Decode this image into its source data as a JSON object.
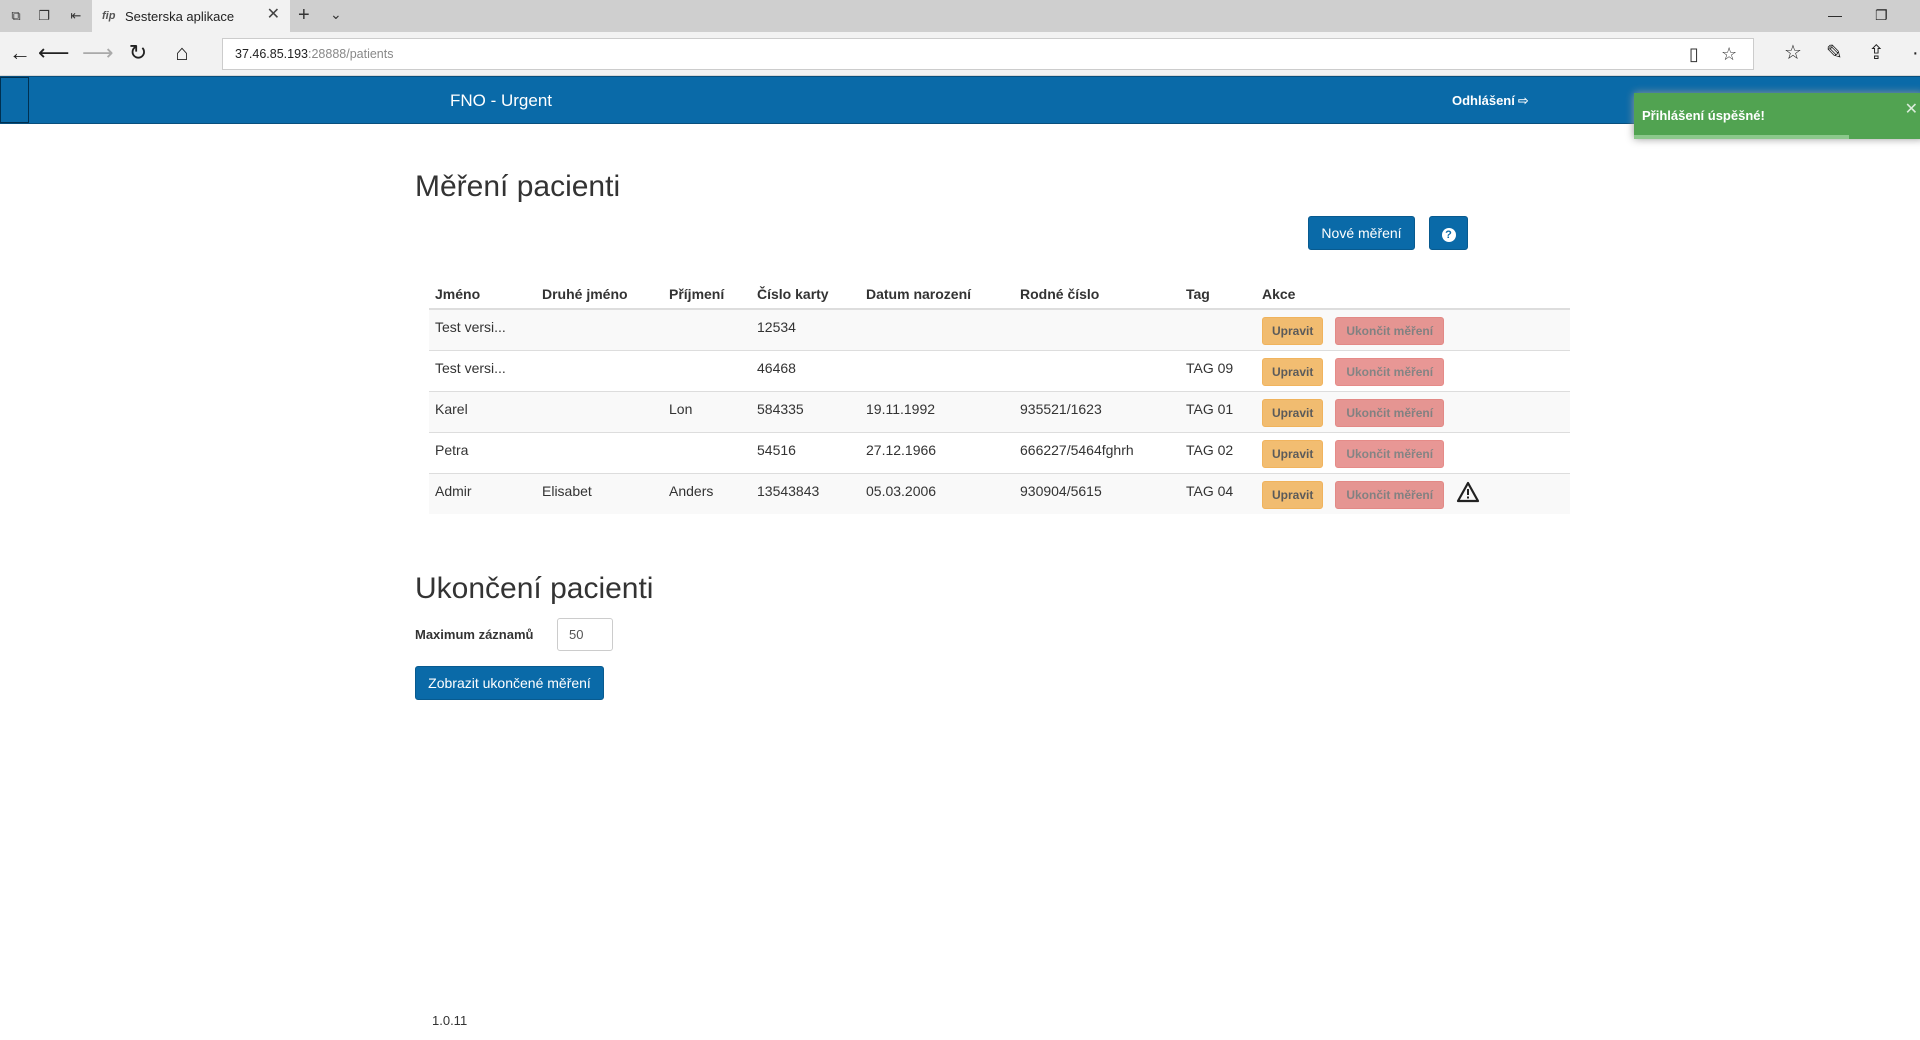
{
  "browser": {
    "tab_title": "Sesterska aplikace",
    "favicon_text": "fip",
    "url_host": "37.46.85.193",
    "url_rest": ":28888/patients"
  },
  "app": {
    "brand": "FNO - Urgent",
    "logout_label": "Odhlášení"
  },
  "toast": {
    "message": "Přihlášení úspěšné!",
    "progress": 0.74
  },
  "measurements": {
    "title": "Měření pacienti",
    "new_button": "Nové měření",
    "help_button": "?",
    "columns": [
      "Jméno",
      "Druhé jméno",
      "Příjmení",
      "Číslo karty",
      "Datum narození",
      "Rodné číslo",
      "Tag",
      "Akce"
    ],
    "edit_label": "Upravit",
    "end_label": "Ukončit měření",
    "rows": [
      {
        "first": "Test versi...",
        "middle": "",
        "last": "",
        "card": "12534",
        "birth": "",
        "rc": "",
        "tag": ""
      },
      {
        "first": "Test versi...",
        "middle": "",
        "last": "",
        "card": "46468",
        "birth": "",
        "rc": "",
        "tag": "TAG 09"
      },
      {
        "first": "Karel",
        "middle": "",
        "last": "Lon",
        "card": "584335",
        "birth": "19.11.1992",
        "rc": "935521/1623",
        "tag": "TAG 01"
      },
      {
        "first": "Petra",
        "middle": "",
        "last": "",
        "card": "54516",
        "birth": "27.12.1966",
        "rc": "666227/5464fghrh",
        "tag": "TAG 02"
      },
      {
        "first": "Admir",
        "middle": "Elisabet",
        "last": "Anders",
        "card": "13543843",
        "birth": "05.03.2006",
        "rc": "930904/5615",
        "tag": "TAG 04"
      }
    ]
  },
  "ended": {
    "title": "Ukončení pacienti",
    "max_label": "Maximum záznamů",
    "max_value": "50",
    "show_button": "Zobrazit ukončené měření"
  },
  "footer": {
    "version": "1.0.11"
  }
}
